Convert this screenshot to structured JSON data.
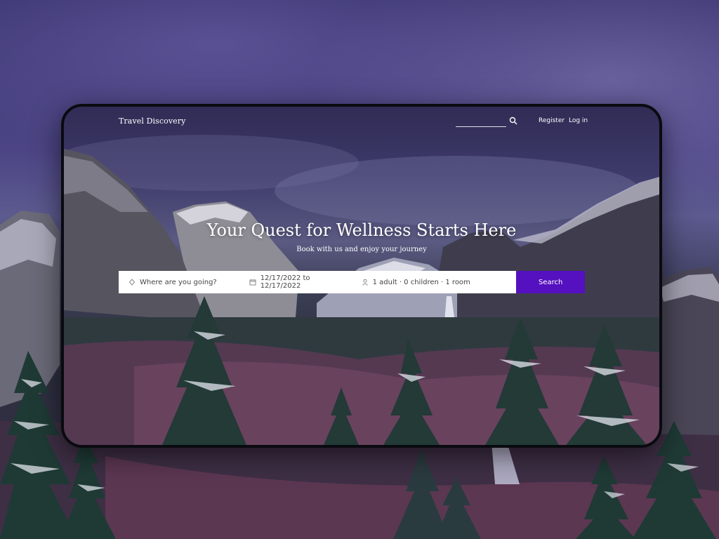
{
  "nav": {
    "brand": "Travel Discovery",
    "search_placeholder": "",
    "register_label": "Register",
    "login_label": "Log in"
  },
  "hero": {
    "title": "Your Quest for Wellness Starts Here",
    "subtitle": "Book with us and enjoy your journey"
  },
  "search_form": {
    "destination_placeholder": "Where are you going?",
    "dates_value": "12/17/2022 to 12/17/2022",
    "guests_value": "1 adult · 0 children · 1 room",
    "search_button_label": "Search"
  },
  "icons": {
    "nav_search": "search-icon",
    "destination": "location-pin-icon",
    "dates": "calendar-icon",
    "guests": "person-icon"
  },
  "colors": {
    "accent": "#5510c0",
    "search_bar_bg": "#ffffff",
    "frame_border": "#0a0a10"
  }
}
